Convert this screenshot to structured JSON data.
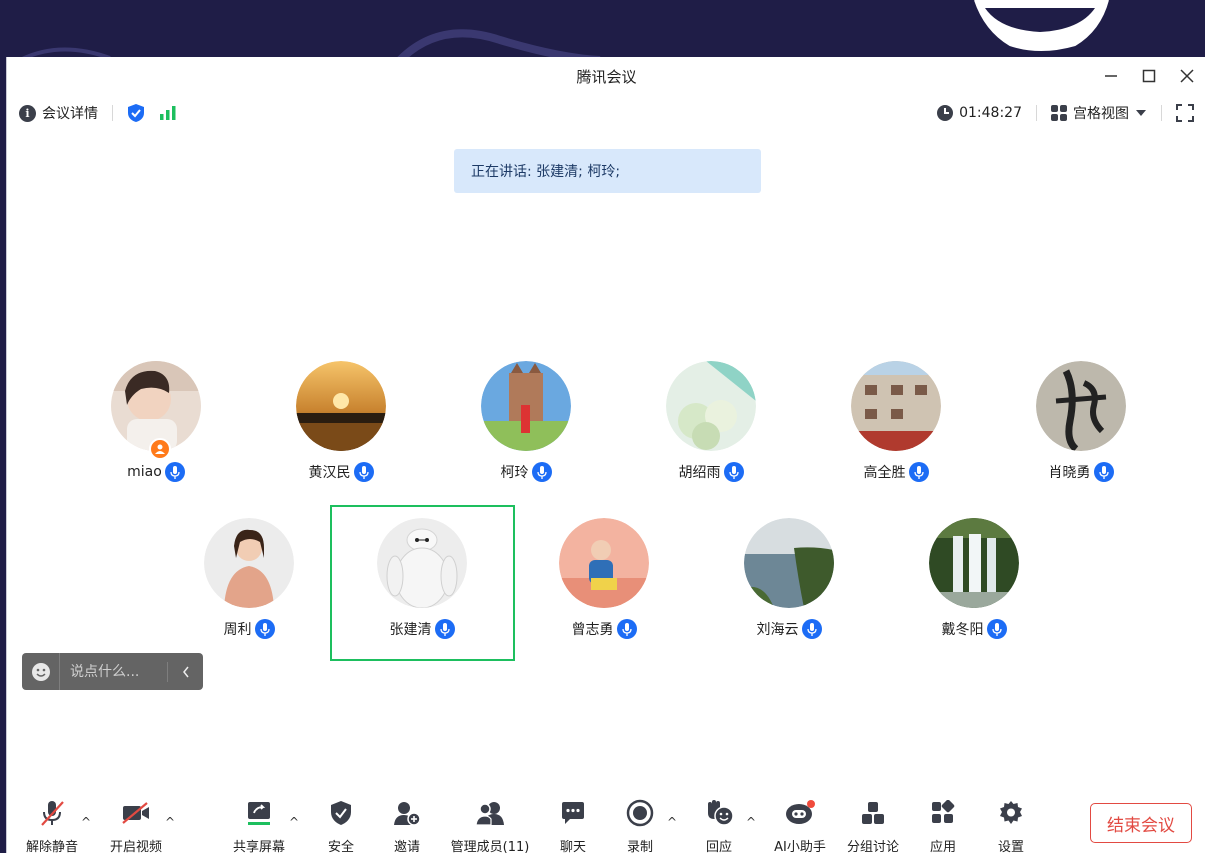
{
  "window": {
    "title": "腾讯会议",
    "controls": [
      "minimize",
      "maximize",
      "close"
    ]
  },
  "topbar": {
    "meeting_info_label": "会议详情",
    "timer": "01:48:27",
    "view_mode_label": "宫格视图"
  },
  "speaking_banner": {
    "text": "正在讲话: 张建清; 柯玲;"
  },
  "participants": [
    {
      "name": "miao",
      "is_host": true
    },
    {
      "name": "黄汉民"
    },
    {
      "name": "柯玲"
    },
    {
      "name": "胡绍雨"
    },
    {
      "name": "高全胜"
    },
    {
      "name": "肖晓勇"
    },
    {
      "name": "周利"
    },
    {
      "name": "张建清",
      "active_speaker": true
    },
    {
      "name": "曾志勇"
    },
    {
      "name": "刘海云"
    },
    {
      "name": "戴冬阳"
    }
  ],
  "chat": {
    "placeholder": "说点什么..."
  },
  "toolbar": {
    "unmute_label": "解除静音",
    "start_video_label": "开启视频",
    "share_screen_label": "共享屏幕",
    "security_label": "安全",
    "invite_label": "邀请",
    "manage_members_label": "管理成员(11)",
    "chat_label": "聊天",
    "record_label": "录制",
    "reactions_label": "回应",
    "ai_assistant_label": "AI小助手",
    "breakout_label": "分组讨论",
    "apps_label": "应用",
    "settings_label": "设置",
    "end_meeting_label": "结束会议"
  },
  "colors": {
    "accent_blue": "#1c6cf5",
    "active_green": "#1dbf5e",
    "end_red": "#e24a42",
    "banner_bg": "#d8e8fb",
    "desktop_bg": "#1f1d47"
  }
}
